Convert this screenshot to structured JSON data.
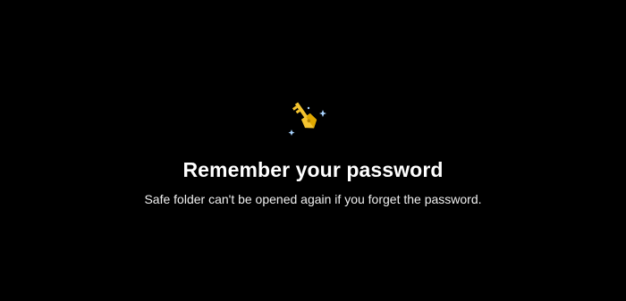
{
  "screen": {
    "title": "Remember your password",
    "description": "Safe folder can't be opened again if you forget the password.",
    "icon": "key-icon",
    "sparkle_icon": "sparkle-icon",
    "colors": {
      "background": "#000000",
      "text": "#ffffff",
      "key": "#f4c430",
      "key_shade": "#e0a800",
      "sparkle": "#a9d4ff"
    }
  }
}
